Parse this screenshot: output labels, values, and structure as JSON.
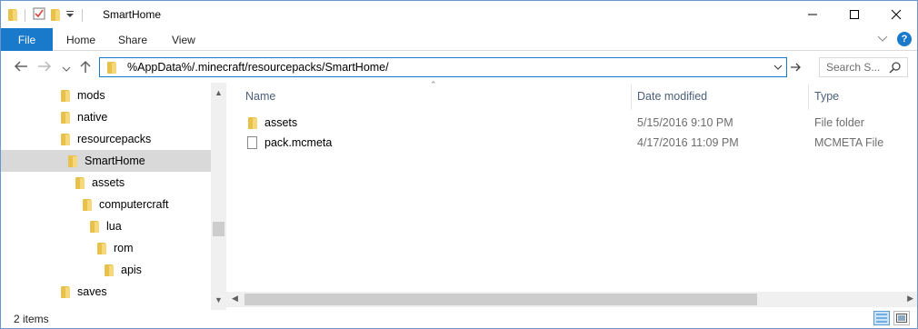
{
  "window": {
    "title": "SmartHome",
    "controls": [
      "minimize-icon",
      "maximize-icon",
      "close-icon"
    ]
  },
  "ribbon": {
    "tabs": [
      {
        "label": "File",
        "active": true
      },
      {
        "label": "Home"
      },
      {
        "label": "Share"
      },
      {
        "label": "View"
      }
    ]
  },
  "address": {
    "path": "%AppData%/.minecraft/resourcepacks/SmartHome/",
    "search_placeholder": "Search S..."
  },
  "nav_tree": [
    {
      "label": "mods",
      "depth": 0
    },
    {
      "label": "native",
      "depth": 0
    },
    {
      "label": "resourcepacks",
      "depth": 0
    },
    {
      "label": "SmartHome",
      "depth": 1,
      "selected": true
    },
    {
      "label": "assets",
      "depth": 2
    },
    {
      "label": "computercraft",
      "depth": 3
    },
    {
      "label": "lua",
      "depth": 4
    },
    {
      "label": "rom",
      "depth": 5
    },
    {
      "label": "apis",
      "depth": 6
    },
    {
      "label": "saves",
      "depth": 0
    }
  ],
  "columns": {
    "name": "Name",
    "date": "Date modified",
    "type": "Type"
  },
  "files": [
    {
      "name": "assets",
      "date": "5/15/2016 9:10 PM",
      "type": "File folder",
      "icon": "folder-icon"
    },
    {
      "name": "pack.mcmeta",
      "date": "4/17/2016 11:09 PM",
      "type": "MCMETA File",
      "icon": "file-icon"
    }
  ],
  "status": {
    "item_count": "2 items"
  },
  "colors": {
    "accent": "#1979ca",
    "folder": "#e8c14a",
    "selection": "#d9d9d9"
  }
}
